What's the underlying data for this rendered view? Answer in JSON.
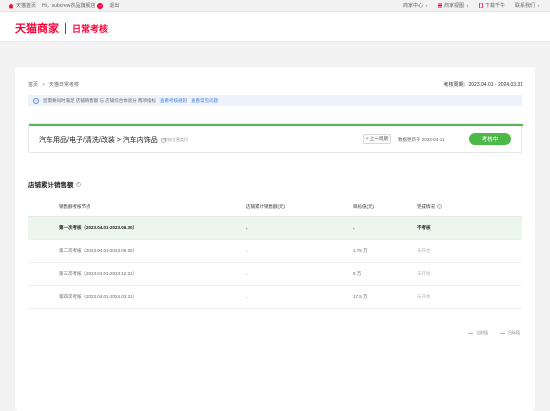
{
  "topbar": {
    "home": "天猫首页",
    "greeting": "Hi，subcrew衣品旗舰店",
    "logout": "退出",
    "merchant_center": "商家中心",
    "merchant_view": "商家视图",
    "download_qianniu": "下载千牛",
    "contact": "联系我们"
  },
  "header": {
    "brand": "天猫商家",
    "subtitle": "日常考核"
  },
  "breadcrumb": [
    "首页",
    "天猫日常考核"
  ],
  "period": "考核周期：2023.04.01 - 2024.03.31",
  "notice": {
    "text": "您需要同时满足 店铺销售额 与 店铺综合体验分 两项指标",
    "link1": "查看考核规则",
    "link2": "查看常见问题"
  },
  "category": {
    "title": "汽车用品/电子/清洗/改装 > 汽车内饰品",
    "hint": "考核主营类目",
    "prev_button": "< 上一周期",
    "updated": "数据更新于 2023-04-11",
    "status": "考核中"
  },
  "section": {
    "title": "店铺累计销售额"
  },
  "table": {
    "headers": [
      "销售额考核节点",
      "店铺累计销售额(元)",
      "目标值(元)",
      "完成情况"
    ],
    "rows": [
      {
        "node": "第一次考核（2023.04.01-2023.06.30）",
        "sales": "-",
        "target": "-",
        "status": "不考核"
      },
      {
        "node": "第二次考核（2023.04.01-2023.09.30）",
        "sales": "-",
        "target": "1.75 万",
        "status": "未开始"
      },
      {
        "node": "第三次考核（2023.04.01-2023.12.31）",
        "sales": "-",
        "target": "6 万",
        "status": "未开始"
      },
      {
        "node": "第四次考核（2023.04.01-2024.03.31）",
        "sales": "-",
        "target": "17.5 万",
        "status": "未开始"
      }
    ]
  },
  "legend": {
    "item1": "当前值",
    "item2": "目标值"
  },
  "colors": {
    "brand_red": "#ff0036",
    "accent_green": "#4cb848",
    "link_blue": "#3c7fe0"
  }
}
